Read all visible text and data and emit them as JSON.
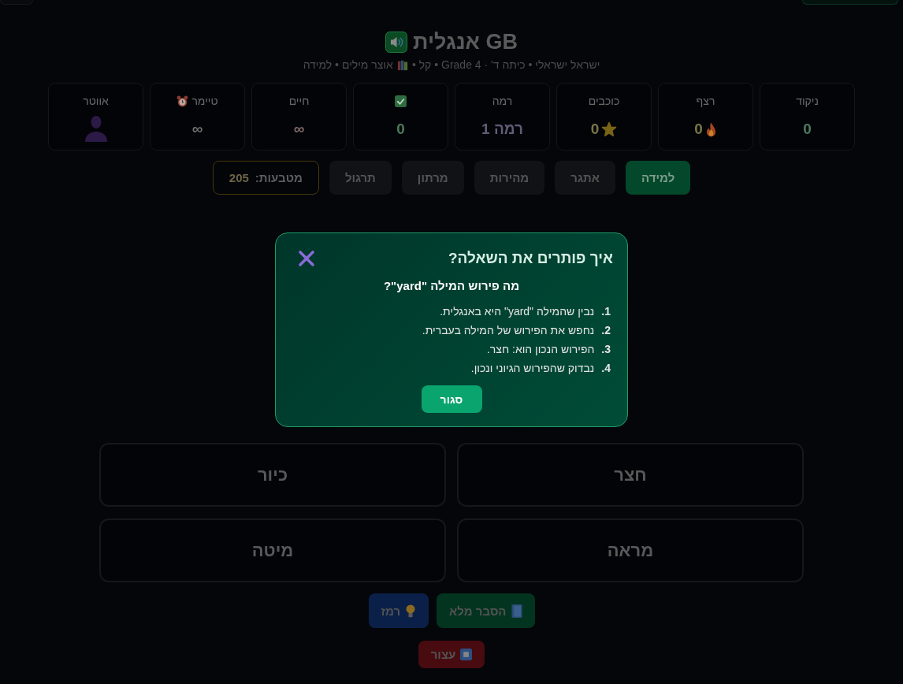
{
  "header": {
    "title": "GB אנגלית",
    "subtitle_start": "ישראל ישראלי • כיתה ד' · Grade 4 • קל •",
    "subtitle_end": "אוצר מילים • למידה"
  },
  "stats": [
    {
      "kind": "score",
      "label": "ניקוד",
      "value": "0"
    },
    {
      "kind": "streak",
      "label": "רצף",
      "value": "0"
    },
    {
      "kind": "stars",
      "label": "כוכבים",
      "value": "0"
    },
    {
      "kind": "level",
      "label": "רמה",
      "value": "רמה 1"
    },
    {
      "kind": "correct",
      "value": "0"
    },
    {
      "kind": "lives",
      "label": "חיים",
      "value": "∞"
    },
    {
      "kind": "timer",
      "label": "טיימר",
      "value": "∞"
    },
    {
      "kind": "avatar",
      "label": "אווטר"
    }
  ],
  "modes": [
    {
      "label": "למידה",
      "selected": true
    },
    {
      "label": "אתגר",
      "selected": false
    },
    {
      "label": "מהירות",
      "selected": false
    },
    {
      "label": "מרתון",
      "selected": false
    },
    {
      "label": "תרגול",
      "selected": false
    }
  ],
  "coins": {
    "label": "מטבעות:",
    "value": "205"
  },
  "dialog": {
    "title": "איך פותרים את השאלה?",
    "question": "מה פירוש המילה \"yard\"?",
    "steps": [
      {
        "number": "1.",
        "text": "נבין שהמילה \"yard\" היא באנגלית."
      },
      {
        "number": "2.",
        "text": "נחפש את הפירוש של המילה בעברית."
      },
      {
        "number": "3.",
        "text": "הפירוש הנכון הוא: חצר."
      },
      {
        "number": "4.",
        "text": "נבדוק שהפירוש הגיוני ונכון."
      }
    ],
    "close_button": "סגור"
  },
  "answers": [
    "חצר",
    "כיור",
    "מראה",
    "מיטה"
  ],
  "actions": [
    {
      "kind": "explain",
      "label": "הסבר מלא"
    },
    {
      "kind": "hint",
      "label": "רמז"
    },
    {
      "kind": "stop",
      "label": "עצור"
    }
  ]
}
